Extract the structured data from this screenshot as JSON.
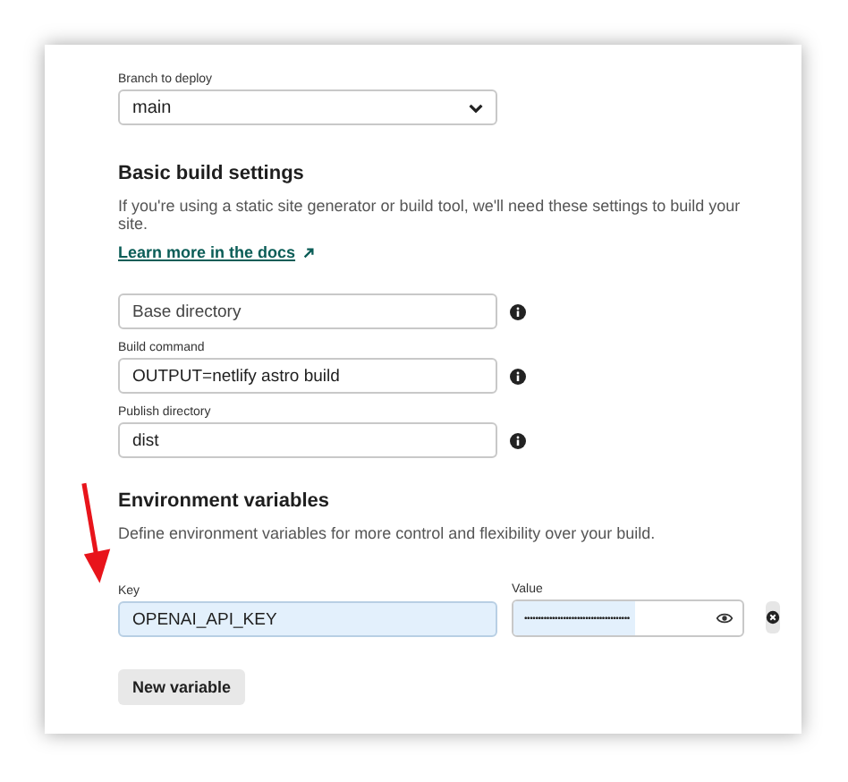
{
  "branch": {
    "label": "Branch to deploy",
    "value": "main"
  },
  "build_settings": {
    "heading": "Basic build settings",
    "description": "If you're using a static site generator or build tool, we'll need these settings to build your site.",
    "link": "Learn more in the docs"
  },
  "fields": [
    {
      "placeholder": "Base directory"
    },
    {
      "label": "Build command",
      "value": "OUTPUT=netlify astro build"
    },
    {
      "label": "Publish directory",
      "value": "dist"
    }
  ],
  "environment": {
    "heading": "Environment variables",
    "description": "Define environment variables for more control and flexibility over your build.",
    "variables": [
      {
        "key_label": "Key",
        "key": "OPENAI_API_KEY",
        "value_label": "Value",
        "value": "••••••••••••••••••••••••••••••••••••••"
      }
    ],
    "button": "New variable"
  }
}
